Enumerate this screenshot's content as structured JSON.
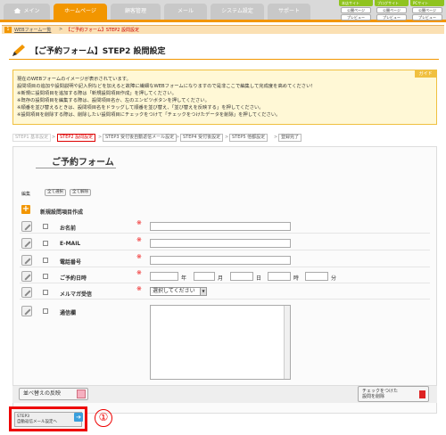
{
  "nav": {
    "tabs": [
      "メイン",
      "ホームページ",
      "顧客管理",
      "メール",
      "システム設定",
      "サポート"
    ],
    "active_tab": "ホームページ",
    "site_boxes": [
      {
        "label": "本店サイト",
        "btn1": "公開ページ",
        "btn2": "プレビュー"
      },
      {
        "label": "ブログサイト",
        "btn1": "公開ページ",
        "btn2": "プレビュー"
      },
      {
        "label": "PCサイト",
        "btn1": "公開ページ",
        "btn2": "プレビュー"
      }
    ]
  },
  "breadcrumb": {
    "num": "1",
    "parent": "WEBフォーム一覧",
    "sep": ">",
    "current": "【ご予約フォーム】STEP2 設問設定"
  },
  "page_title": "【ご予約フォーム】STEP2 設問設定",
  "guide": {
    "tag": "ガイド",
    "lines": [
      "現在のWEBフォームのイメージが表示されています。",
      "設問項目の追加や設問説明や記入例などを加えると故障に繊細なWEBフォームになりますので是非ここで編集して完成度を高めてください！",
      "※新規に設問項目を追加する際は「新規設問項目作成」を押してください。",
      "※既存の設問項目を編集する際は、設問項目名か、左のエンピツボタンを押してください。",
      "※順番を並び替えるときは、設問項目名をドラッグして順番を並び替え、「並び替えを反映する」を押してください。",
      "※設問項目を削除する際は、削除したい設問項目にチェックをつけて「チェックをつけたデータを削除」を押してください。"
    ]
  },
  "steps": [
    "STEP1 基本設定",
    "STEP2 設問設定",
    "STEP3 受付後自動返信メール設定",
    "STEP4 受付後設定",
    "STEP5 他都設定",
    "登録完了"
  ],
  "form": {
    "title": "ご予約フォーム",
    "edit_label": "編集",
    "select_all": "全て選択",
    "deselect_all": "全て解除",
    "new_item": "新規設問項目作成",
    "required_mark": "※",
    "fields": [
      "お名前",
      "E-MAIL",
      "電話番号",
      "ご予約日時",
      "メルマガ受信",
      "通信欄"
    ],
    "date_units": [
      "年",
      "月",
      "日",
      "時",
      "分"
    ],
    "select_value": "選択してください",
    "sort_button": "並べ替えの反映",
    "delete_button": [
      "チェックをつけた",
      "設問を削除"
    ],
    "next_button": [
      "STEP3",
      "自動返信メール設定へ"
    ],
    "annotation": "①"
  }
}
